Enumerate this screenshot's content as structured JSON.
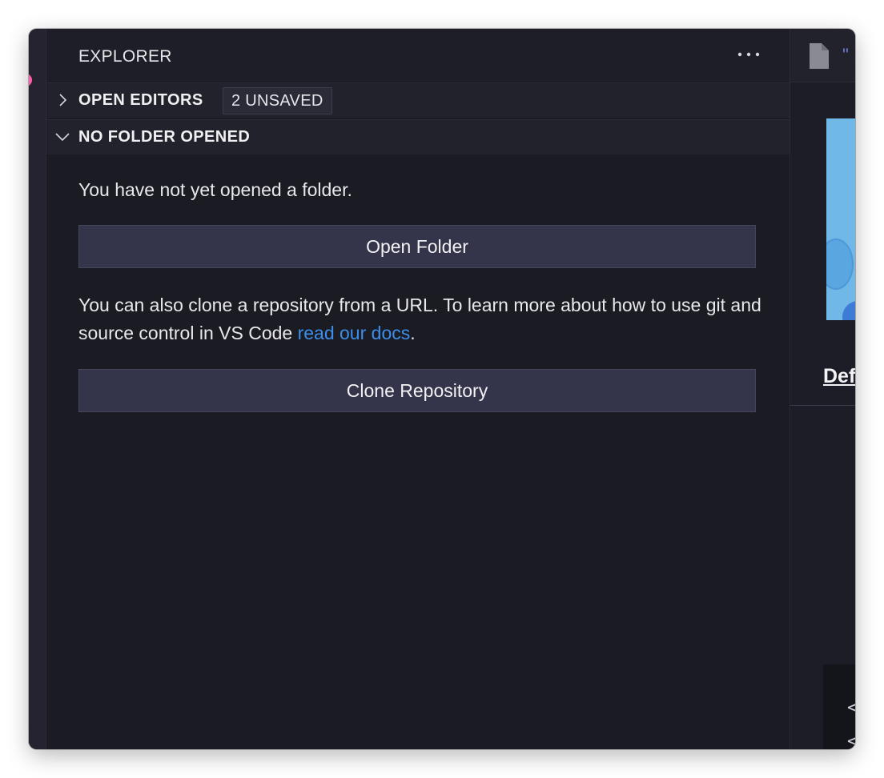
{
  "sidebar": {
    "title": "EXPLORER",
    "more_icon": "more-horizontal-icon",
    "sections": {
      "open_editors": {
        "label": "OPEN EDITORS",
        "badge": "2 UNSAVED",
        "icon": "chevron-right-icon"
      },
      "no_folder": {
        "label": "NO FOLDER OPENED",
        "icon": "chevron-down-icon",
        "message": "You have not yet opened a folder.",
        "open_folder_label": "Open Folder",
        "clone_text_before": "You can also clone a repository from a URL. To learn more about how to use git and source control in VS Code ",
        "clone_link": "read our docs",
        "clone_text_after": ".",
        "clone_button_label": "Clone Repository"
      }
    }
  },
  "editor": {
    "tab_icon": "file-icon",
    "tab_text": "\"",
    "heading": "Def",
    "code_lines": [
      "<",
      "<"
    ]
  },
  "colors": {
    "background": "#1b1b24",
    "link": "#3b8eea",
    "button": "#34344a",
    "badge_accent": "#ff5fa8"
  }
}
